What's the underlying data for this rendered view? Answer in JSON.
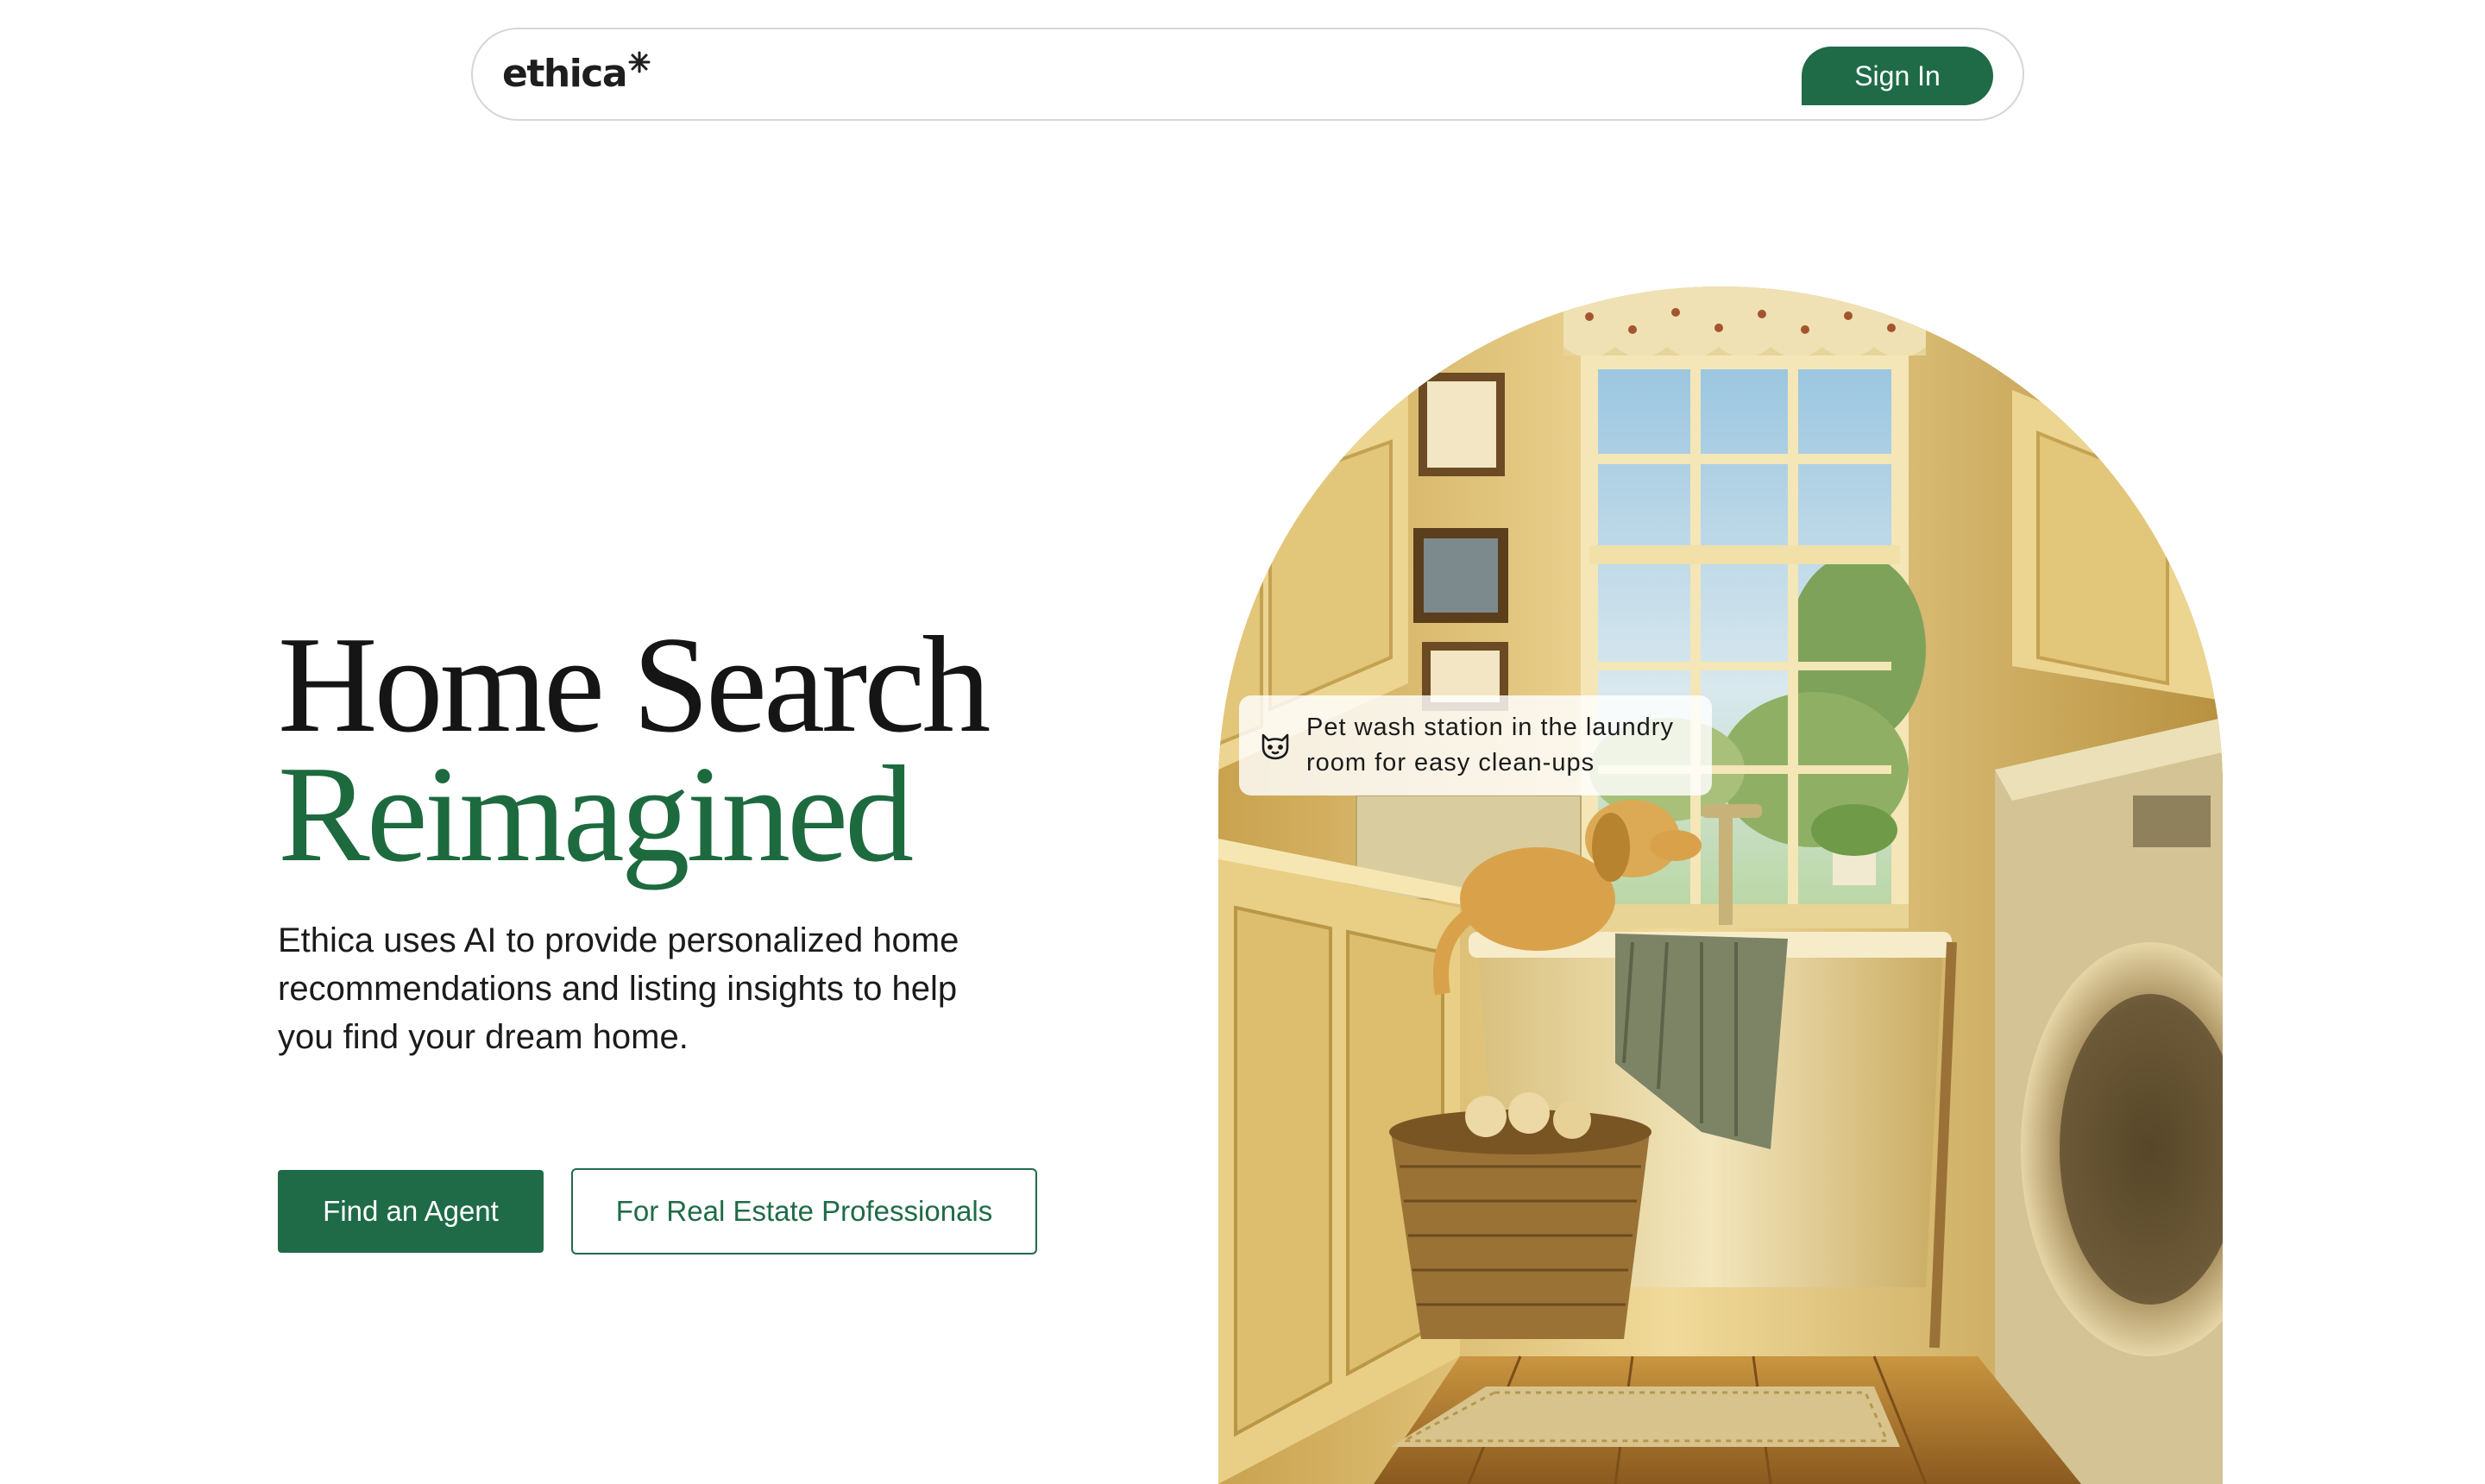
{
  "header": {
    "logo_text": "ethica",
    "signin_label": "Sign In"
  },
  "hero": {
    "title_line1": "Home Search",
    "title_line2": "Reimagined",
    "description": "Ethica uses AI to provide personalized home recommendations and listing insights to help you find your dream home.",
    "primary_cta": "Find an Agent",
    "secondary_cta": "For Real Estate Professionals"
  },
  "feature_card": {
    "icon": "pet-icon",
    "text": "Pet wash station in the laundry room for easy clean-ups"
  },
  "colors": {
    "brand_green": "#1f6b47",
    "accent_green": "#1d6a3f",
    "text_dark": "#151515",
    "nav_border": "#d6d6d6"
  }
}
